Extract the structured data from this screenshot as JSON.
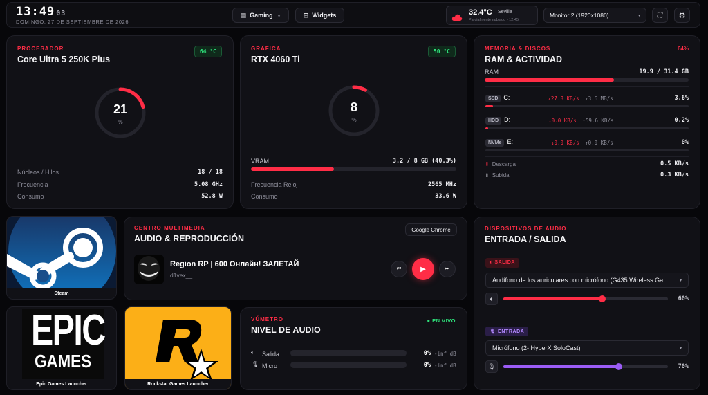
{
  "header": {
    "time_hm": "13:49",
    "time_s": "03",
    "date": "DOMINGO, 27 DE SEPTIEMBRE DE 2026",
    "profile_label": "Gaming",
    "widgets_label": "Widgets",
    "weather_temp": "32.4°C",
    "weather_city": "Seville",
    "weather_desc": "Parcialmente nublado • 12:45",
    "monitor_value": "Monitor 2 (1920x1080)"
  },
  "cpu": {
    "label": "PROCESADOR",
    "name": "Core Ultra 5 250K Plus",
    "temp": "64 °C",
    "usage": "21",
    "usage_unit": "%",
    "usage_value": 21,
    "cores_label": "Núcleos / Hilos",
    "cores_value": "18 / 18",
    "freq_label": "Frecuencia",
    "freq_value": "5.08 GHz",
    "power_label": "Consumo",
    "power_value": "52.8 W"
  },
  "gpu": {
    "label": "GRÁFICA",
    "name": "RTX 4060 Ti",
    "temp": "50 °C",
    "usage": "8",
    "usage_unit": "%",
    "usage_value": 8,
    "vram_label": "VRAM",
    "vram_value": "3.2 / 8 GB (40.3%)",
    "vram_fraction": 0.403,
    "clock_label": "Frecuencia Reloj",
    "clock_value": "2565 MHz",
    "power_label": "Consumo",
    "power_value": "33.6 W"
  },
  "memory": {
    "label": "MEMORIA & DISCOS",
    "title": "RAM & ACTIVIDAD",
    "percent": "64%",
    "ram_label": "RAM",
    "ram_value": "19.9 / 31.4 GB",
    "ram_fraction": 0.634,
    "disks": [
      {
        "type": "SSD",
        "letter": "C:",
        "read": "↓27.8 KB/s",
        "write": "↑3.6 MB/s",
        "pct": "3.6%",
        "fraction": 0.036
      },
      {
        "type": "HDD",
        "letter": "D:",
        "read": "↓0.0 KB/s",
        "write": "↑59.6 KB/s",
        "pct": "0.2%",
        "fraction": 0.002
      },
      {
        "type": "NVMe",
        "letter": "E:",
        "read": "↓0.0 KB/s",
        "write": "↑0.0 KB/s",
        "pct": "0%",
        "fraction": 0
      }
    ],
    "download_label": "Descarga",
    "download_value": "0.5 KB/s",
    "upload_label": "Subida",
    "upload_value": "0.3 KB/s"
  },
  "launchers": {
    "steam": "Steam",
    "epic": "Epic Games Launcher",
    "epic_logo_line1": "EPIC",
    "epic_logo_line2": "GAMES",
    "rockstar": "Rockstar Games Launcher"
  },
  "media": {
    "label": "CENTRO MULTIMEDIA",
    "title": "AUDIO & REPRODUCCIÓN",
    "source": "Google Chrome",
    "track": "Region RP | 600 Онлайн! ЗАЛЕТАЙ",
    "artist": "d1vex__"
  },
  "meter": {
    "label": "VÚMETRO",
    "title": "NIVEL DE AUDIO",
    "live": "EN VIVO",
    "out_label": "Salida",
    "out_pct": "0%",
    "out_db": "-inf dB",
    "mic_label": "Micro",
    "mic_pct": "0%",
    "mic_db": "-inf dB"
  },
  "audio": {
    "label": "DISPOSITIVOS DE AUDIO",
    "title": "ENTRADA / SALIDA",
    "out_tag": "SALIDA",
    "out_device": "Audífono de los auriculares con micrófono (G435 Wireless Ga...",
    "out_volume": "60%",
    "out_fraction": 0.6,
    "in_tag": "ENTRADA",
    "in_device": "Micrófono (2- HyperX SoloCast)",
    "in_volume": "70%",
    "in_fraction": 0.7
  },
  "colors": {
    "accent": "#ff2d46",
    "ok": "#2ee07a",
    "mic": "#9b5cf6"
  }
}
